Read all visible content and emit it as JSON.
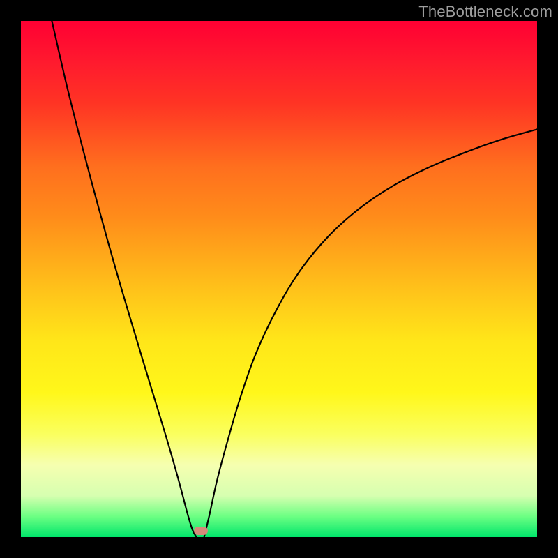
{
  "watermark": "TheBottleneck.com",
  "chart_data": {
    "type": "line",
    "title": "",
    "xlabel": "",
    "ylabel": "",
    "x_range": [
      0,
      1
    ],
    "y_range": [
      0,
      1
    ],
    "left_curve": [
      {
        "x": 0.06,
        "y": 1.0
      },
      {
        "x": 0.09,
        "y": 0.87
      },
      {
        "x": 0.12,
        "y": 0.752
      },
      {
        "x": 0.15,
        "y": 0.64
      },
      {
        "x": 0.18,
        "y": 0.532
      },
      {
        "x": 0.21,
        "y": 0.43
      },
      {
        "x": 0.24,
        "y": 0.33
      },
      {
        "x": 0.265,
        "y": 0.248
      },
      {
        "x": 0.285,
        "y": 0.182
      },
      {
        "x": 0.3,
        "y": 0.13
      },
      {
        "x": 0.312,
        "y": 0.086
      },
      {
        "x": 0.322,
        "y": 0.048
      },
      {
        "x": 0.332,
        "y": 0.015
      },
      {
        "x": 0.34,
        "y": 0.0
      }
    ],
    "right_curve": [
      {
        "x": 0.355,
        "y": 0.0
      },
      {
        "x": 0.365,
        "y": 0.042
      },
      {
        "x": 0.38,
        "y": 0.11
      },
      {
        "x": 0.4,
        "y": 0.185
      },
      {
        "x": 0.425,
        "y": 0.27
      },
      {
        "x": 0.455,
        "y": 0.355
      },
      {
        "x": 0.495,
        "y": 0.44
      },
      {
        "x": 0.54,
        "y": 0.515
      },
      {
        "x": 0.595,
        "y": 0.582
      },
      {
        "x": 0.655,
        "y": 0.636
      },
      {
        "x": 0.72,
        "y": 0.68
      },
      {
        "x": 0.79,
        "y": 0.716
      },
      {
        "x": 0.86,
        "y": 0.745
      },
      {
        "x": 0.93,
        "y": 0.77
      },
      {
        "x": 1.0,
        "y": 0.79
      }
    ],
    "marker": {
      "x": 0.348,
      "y": 0.012,
      "color": "#d38b7a"
    },
    "background_gradient": {
      "top_color": "#ff0033",
      "bottom_color": "#00e66b"
    }
  }
}
